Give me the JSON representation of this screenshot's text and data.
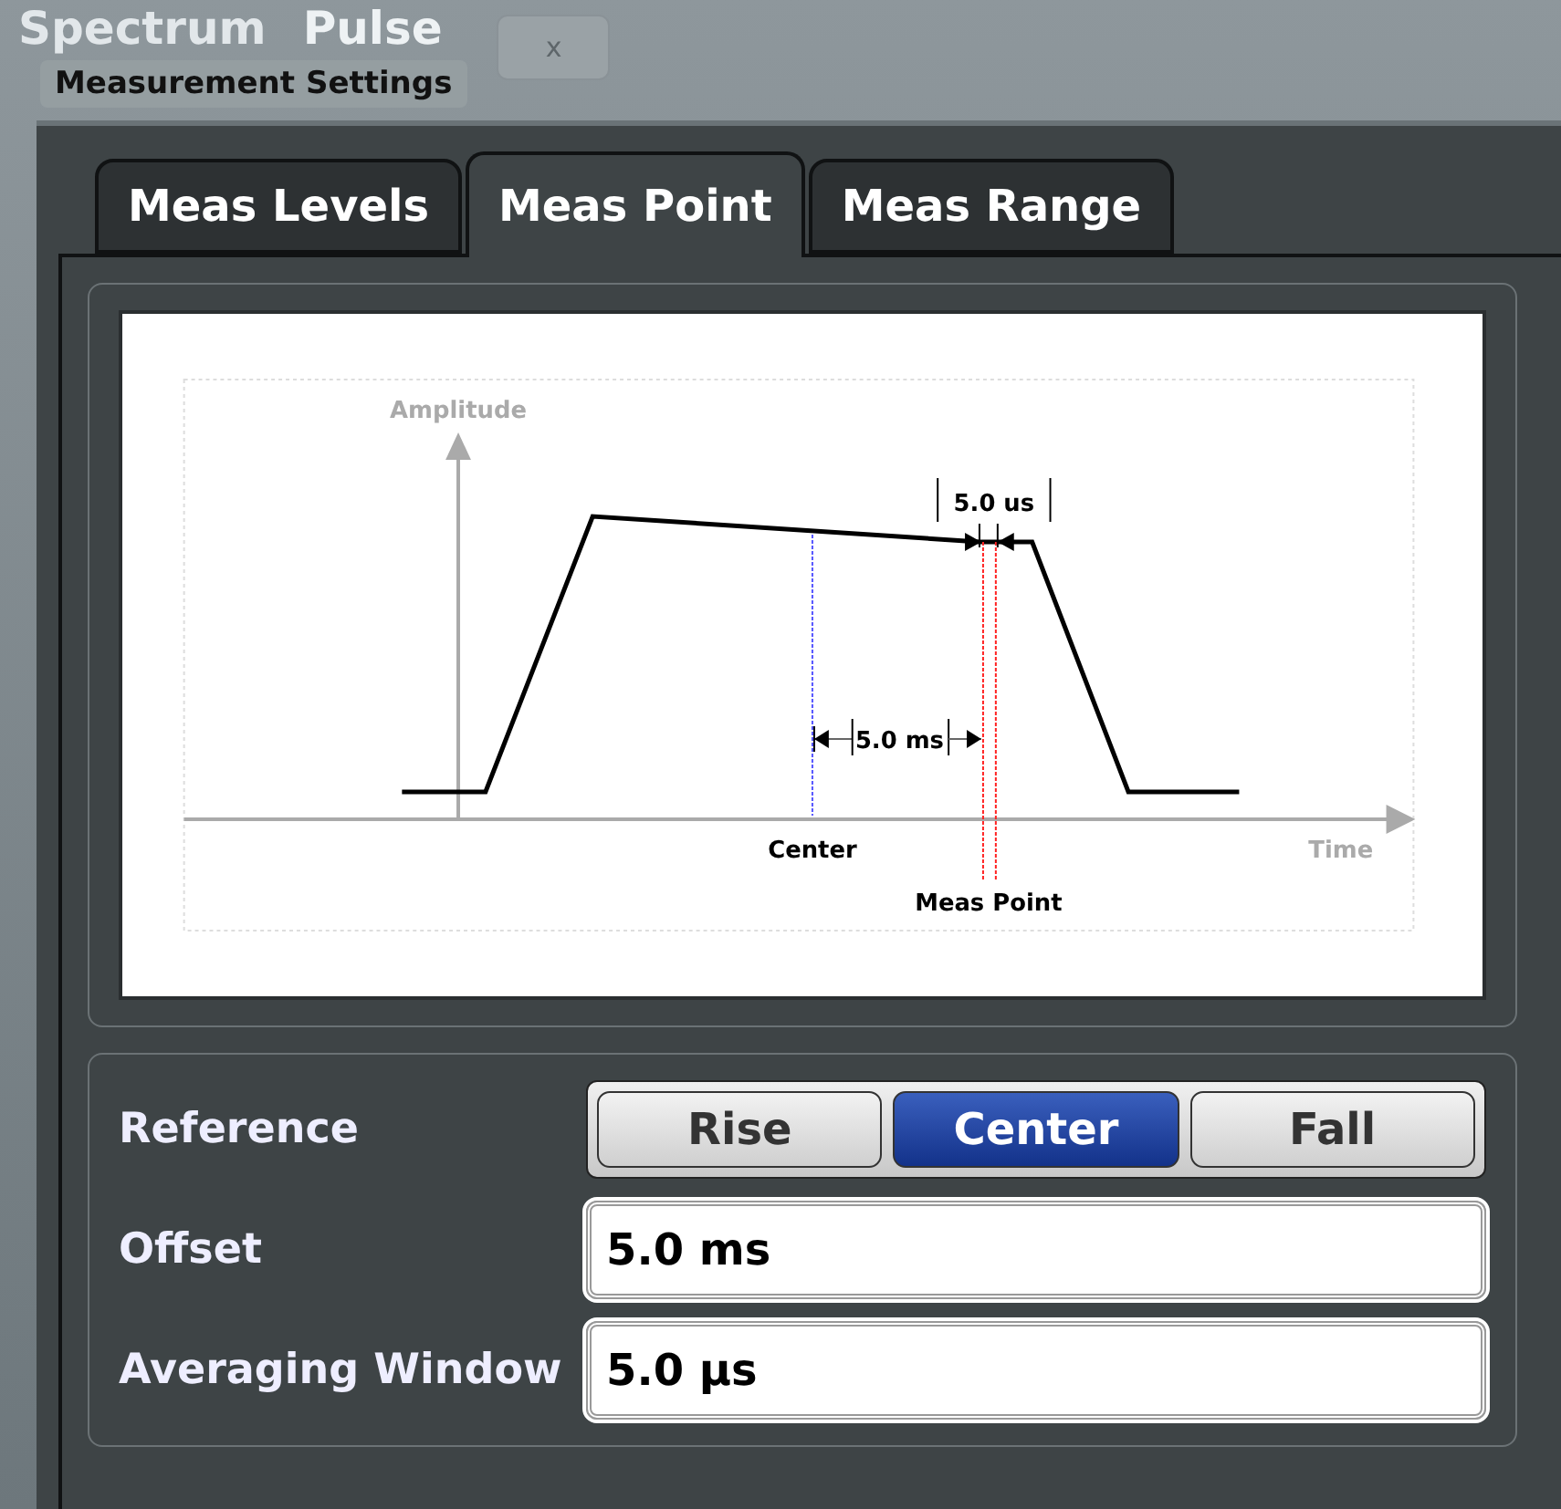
{
  "app_tabs": [
    {
      "label": "Spectrum",
      "selected": false
    },
    {
      "label": "Pulse",
      "close": "x",
      "selected": true
    }
  ],
  "dialog": {
    "title": "Measurement Settings"
  },
  "tabs": [
    {
      "label": "Meas Levels",
      "selected": false
    },
    {
      "label": "Meas Point",
      "selected": true
    },
    {
      "label": "Meas Range",
      "selected": false
    }
  ],
  "diagram": {
    "y_axis": "Amplitude",
    "x_axis": "Time",
    "center_label": "Center",
    "meas_point_label": "Meas Point",
    "offset_label": "5.0 ms",
    "window_label": "5.0 us"
  },
  "reference": {
    "label": "Reference",
    "options": [
      {
        "label": "Rise",
        "selected": false
      },
      {
        "label": "Center",
        "selected": true
      },
      {
        "label": "Fall",
        "selected": false
      }
    ]
  },
  "fields": [
    {
      "label": "Offset",
      "value": "5.0 ms"
    },
    {
      "label": "Averaging Window",
      "value": "5.0 µs"
    }
  ]
}
